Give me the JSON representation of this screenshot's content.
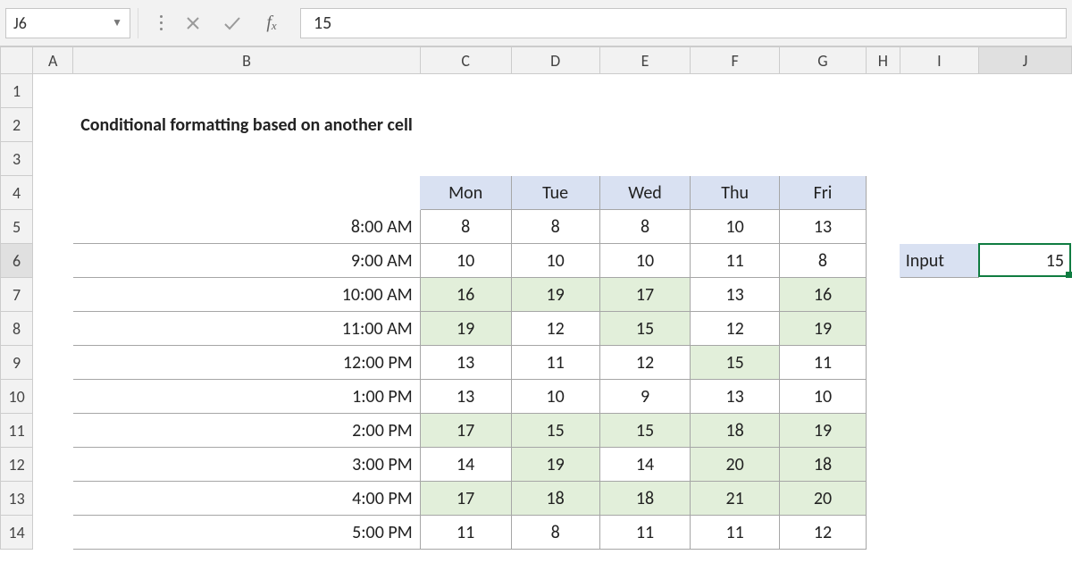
{
  "name_box": "J6",
  "formula_value": "15",
  "columns": [
    "A",
    "B",
    "C",
    "D",
    "E",
    "F",
    "G",
    "H",
    "I",
    "J"
  ],
  "row_numbers": [
    "1",
    "2",
    "3",
    "4",
    "5",
    "6",
    "7",
    "8",
    "9",
    "10",
    "11",
    "12",
    "13",
    "14"
  ],
  "title": "Conditional formatting based on another cell",
  "day_headers": [
    "Mon",
    "Tue",
    "Wed",
    "Thu",
    "Fri"
  ],
  "threshold": 15,
  "input_label": "Input",
  "input_value": "15",
  "rows": [
    {
      "time": "8:00 AM",
      "vals": [
        8,
        8,
        8,
        10,
        13
      ]
    },
    {
      "time": "9:00 AM",
      "vals": [
        10,
        10,
        10,
        11,
        8
      ]
    },
    {
      "time": "10:00 AM",
      "vals": [
        16,
        19,
        17,
        13,
        16
      ]
    },
    {
      "time": "11:00 AM",
      "vals": [
        19,
        12,
        15,
        12,
        19
      ]
    },
    {
      "time": "12:00 PM",
      "vals": [
        13,
        11,
        12,
        15,
        11
      ]
    },
    {
      "time": "1:00 PM",
      "vals": [
        13,
        10,
        9,
        13,
        10
      ]
    },
    {
      "time": "2:00 PM",
      "vals": [
        17,
        15,
        15,
        18,
        19
      ]
    },
    {
      "time": "3:00 PM",
      "vals": [
        14,
        19,
        14,
        20,
        18
      ]
    },
    {
      "time": "4:00 PM",
      "vals": [
        17,
        18,
        18,
        21,
        20
      ]
    },
    {
      "time": "5:00 PM",
      "vals": [
        11,
        8,
        11,
        11,
        12
      ]
    }
  ]
}
